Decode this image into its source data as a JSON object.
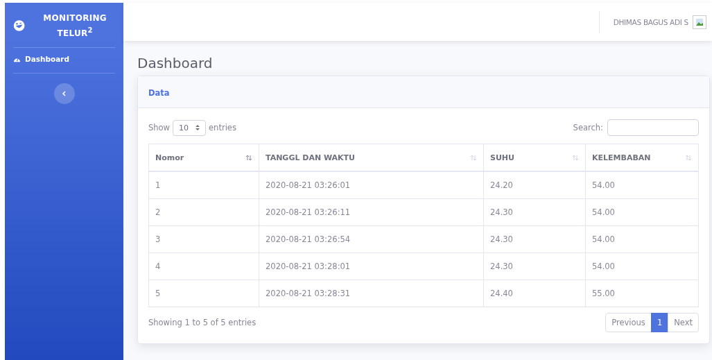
{
  "sidebar": {
    "brand": "MONITORING TELUR$^{2}$",
    "items": [
      {
        "label": "Dashboard",
        "selected": true
      }
    ]
  },
  "topbar": {
    "user_name": "DHIMAS BAGUS ADI S"
  },
  "page_title": "Dashboard",
  "card": {
    "title": "Data",
    "length_menu": {
      "show": "Show",
      "value": "10",
      "entries": "entries"
    },
    "search": {
      "label": "Search:"
    },
    "table": {
      "columns": [
        "Nomor",
        "TANGGL DAN WAKTU",
        "SUHU",
        "KELEMBABAN"
      ],
      "rows": [
        [
          "1",
          "2020-08-21 03:26:01",
          "24.20",
          "54.00"
        ],
        [
          "2",
          "2020-08-21 03:26:11",
          "24.30",
          "54.00"
        ],
        [
          "3",
          "2020-08-21 03:26:54",
          "24.30",
          "54.00"
        ],
        [
          "4",
          "2020-08-21 03:28:01",
          "24.30",
          "54.00"
        ],
        [
          "5",
          "2020-08-21 03:28:31",
          "24.40",
          "55.00"
        ]
      ]
    },
    "info": "Showing 1 to 5 of 5 entries",
    "pagination": {
      "previous": "Previous",
      "pages": [
        {
          "label": "1",
          "selected": true
        }
      ],
      "next": "Next"
    }
  }
}
